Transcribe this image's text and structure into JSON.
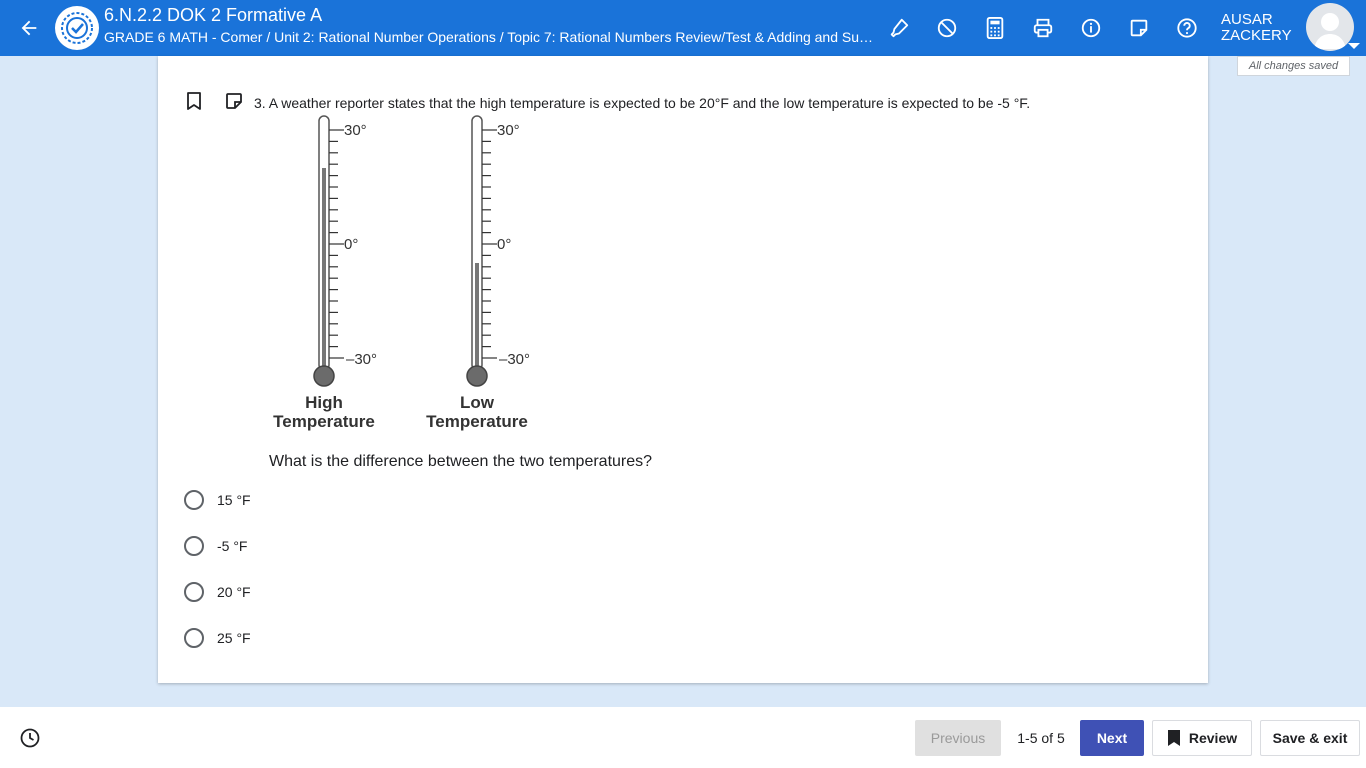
{
  "header": {
    "title": "6.N.2.2 DOK 2 Formative A",
    "breadcrumb": "GRADE 6 MATH - Comer / Unit 2: Rational Number Operations / Topic 7: Rational Numbers Review/Test & Adding and Subtr...",
    "user_first": "AUSAR",
    "user_last": "ZACKERY",
    "saved_status": "All changes saved",
    "tools": [
      "highlighter-icon",
      "eliminate-icon",
      "calculator-icon",
      "print-icon",
      "info-icon",
      "sticky-note-icon",
      "help-icon"
    ]
  },
  "question": {
    "text": "3. A weather reporter states that the high temperature is expected to be 20°F and the low temperature is expected to be -5 °F.",
    "prompt": "What is the difference between the two temperatures?",
    "choices": [
      "15 °F",
      "-5 °F",
      "20 °F",
      "25 °F"
    ]
  },
  "thermometers": [
    {
      "label1": "High",
      "label2": "Temperature",
      "value": 20,
      "top": "30°",
      "mid": "0°",
      "bottom": "–30°"
    },
    {
      "label1": "Low",
      "label2": "Temperature",
      "value": -5,
      "top": "30°",
      "mid": "0°",
      "bottom": "–30°"
    }
  ],
  "footer": {
    "previous": "Previous",
    "pager": "1-5 of 5",
    "next": "Next",
    "review": "Review",
    "save_exit": "Save & exit"
  },
  "colors": {
    "header": "#1a73d9",
    "page": "#d9e8f8",
    "next": "#3f51b5"
  }
}
